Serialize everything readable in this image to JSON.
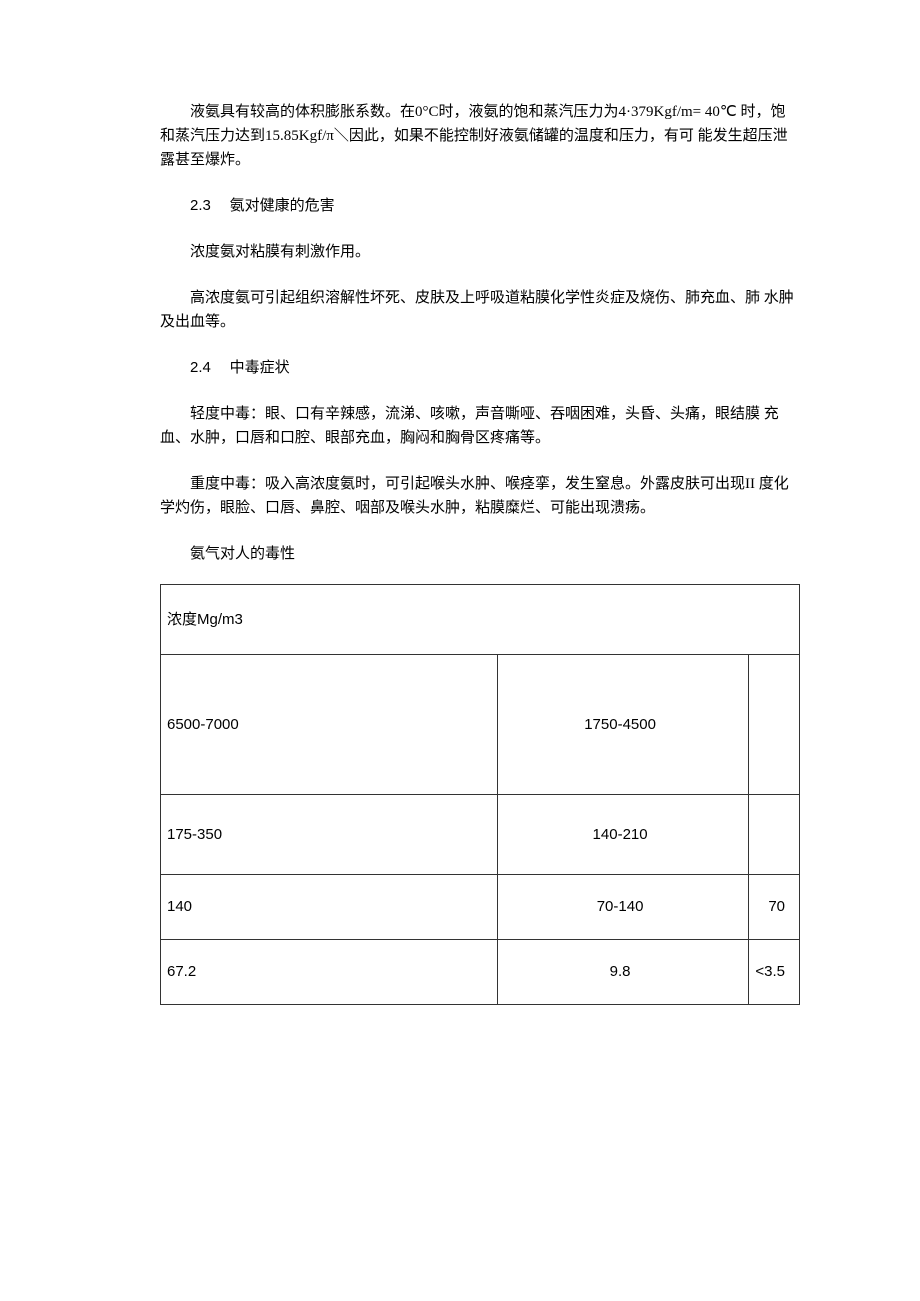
{
  "paragraphs": {
    "p1": "液氨具有较高的体积膨胀系数。在0°C时，液氨的饱和蒸汽压力为4·379Kgf/m= 40℃ 时，饱和蒸汽压力达到15.85Kgf/π＼因此，如果不能控制好液氨储罐的温度和压力，有可 能发生超压泄露甚至爆炸。",
    "s23_num": "2.3",
    "s23_title": "氨对健康的危害",
    "p2": "浓度氨对粘膜有刺激作用。",
    "p3": "高浓度氨可引起组织溶解性坏死、皮肤及上呼吸道粘膜化学性炎症及烧伤、肺充血、肺 水肿及出血等。",
    "s24_num": "2.4",
    "s24_title": "中毒症状",
    "p4": "轻度中毒：眼、口有辛辣感，流涕、咳嗽，声音嘶哑、吞咽困难，头昏、头痛，眼结膜 充血、水肿，口唇和口腔、眼部充血，胸闷和胸骨区疼痛等。",
    "p5": "重度中毒：吸入高浓度氨时，可引起喉头水肿、喉痉挛，发生窒息。外露皮肤可出现II 度化学灼伤，眼脸、口唇、鼻腔、咽部及喉头水肿，粘膜糜烂、可能出现溃疡。",
    "table_title": "氨气对人的毒性"
  },
  "chart_data": {
    "type": "table",
    "title": "氨气对人的毒性",
    "header": [
      "浓度Mg/m3",
      "",
      ""
    ],
    "rows": [
      [
        "6500-7000",
        "1750-4500",
        ""
      ],
      [
        "175-350",
        "140-210",
        ""
      ],
      [
        "140",
        "70-140",
        "70"
      ],
      [
        "67.2",
        "9.8",
        "<3.5"
      ]
    ]
  }
}
